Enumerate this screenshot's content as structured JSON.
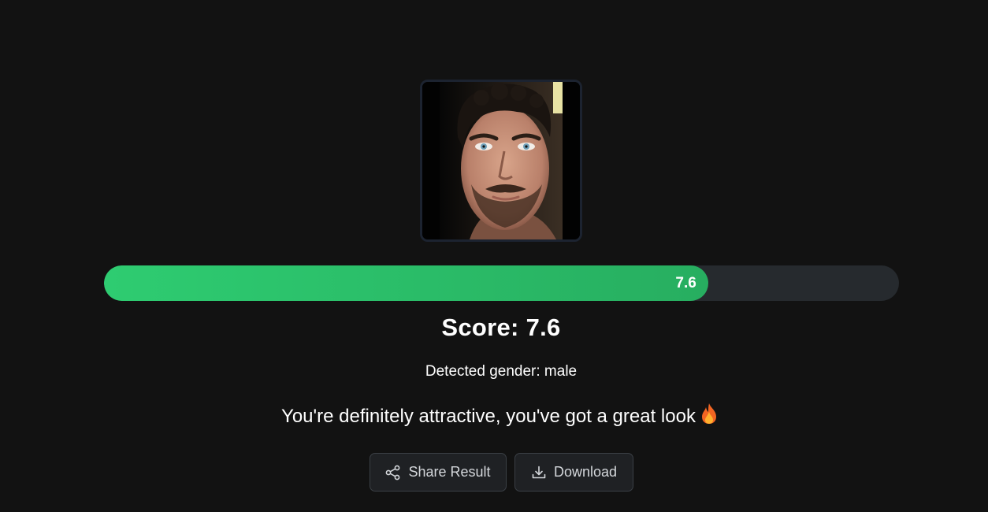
{
  "result": {
    "photo_alt": "Uploaded face photo",
    "score_value": 7.6,
    "score_max": 10,
    "bar_label": "7.6",
    "score_heading": "Score: 7.6",
    "gender_text": "Detected gender: male",
    "message": "You're definitely attractive, you've got a great look",
    "message_icon": "fire-icon"
  },
  "actions": {
    "share_label": "Share Result",
    "share_icon": "share-icon",
    "download_label": "Download",
    "download_icon": "download-icon"
  },
  "colors": {
    "background": "#121212",
    "bar_fill_start": "#2ecc71",
    "bar_fill_end": "#27ae60",
    "bar_track": "#262a2e",
    "button_bg": "#1f2124",
    "button_border": "#3a3f45"
  }
}
